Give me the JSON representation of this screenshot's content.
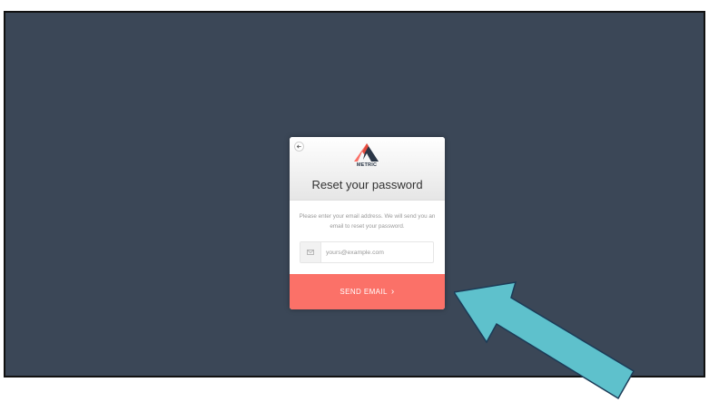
{
  "dialog": {
    "logo_text": "METRIC",
    "title": "Reset your password",
    "description": "Please enter your email address. We will send you an email to reset your password.",
    "email_placeholder": "yours@example.com",
    "send_button_label": "SEND EMAIL",
    "send_button_chevron": "›"
  },
  "colors": {
    "background": "#3b4757",
    "button": "#fb7168",
    "annotation_arrow": "#5ec1cc"
  },
  "icons": {
    "back": "arrow-left-icon",
    "email": "envelope-icon",
    "annotation": "arrow-annotation"
  }
}
